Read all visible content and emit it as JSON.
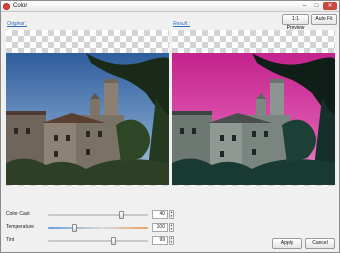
{
  "window": {
    "title": "Color",
    "controls": {
      "minimize": "–",
      "maximize": "□",
      "close": "✕"
    }
  },
  "toolbar": {
    "preview_label": "1:1 Preview",
    "autofit_label": "Auto Fit"
  },
  "panels": {
    "original_label": "Original :",
    "result_label": "Result :"
  },
  "controls": [
    {
      "label": "Color Cast",
      "value": "40",
      "level": 0.73
    },
    {
      "label": "Temperature",
      "value": "100",
      "level": 0.26
    },
    {
      "label": "Tint",
      "value": "99",
      "level": 0.65
    }
  ],
  "footer": {
    "apply_label": "Apply",
    "cancel_label": "Cancel"
  },
  "colors": {
    "accent_link": "#2f6db5",
    "result_tint": "#d0359a",
    "close_button": "#c94a3c"
  },
  "icons": {
    "app": "app-logo-icon",
    "spin_up": "spin-up-icon",
    "spin_down": "spin-down-icon"
  }
}
